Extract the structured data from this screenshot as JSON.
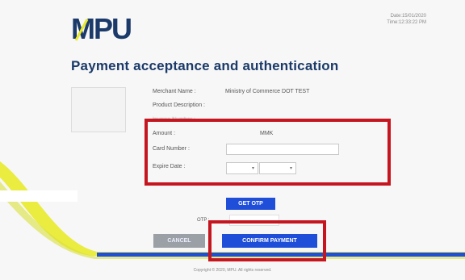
{
  "header": {
    "logo_text": "MPU",
    "date": "Date:15/01/2020",
    "time": "Time:12:33:22 PM"
  },
  "page": {
    "title": "Payment acceptance and authentication"
  },
  "details": {
    "merchant_label": "Merchant Name :",
    "merchant_value": "Ministry of Commerce DOT TEST",
    "product_label": "Product Description :",
    "invoice_label": "Invoice Number :",
    "amount_label": "Amount :",
    "amount_currency": "MMK",
    "card_label": "Card Number :",
    "expire_label": "Expire Date :"
  },
  "buttons": {
    "get_otp": "GET OTP",
    "cancel": "CANCEL",
    "confirm": "CONFIRM PAYMENT"
  },
  "otp": {
    "label": "OTP :"
  },
  "footer": {
    "copyright": "Copyright © 2020, MPU. All rights reserved."
  },
  "colors": {
    "brand_blue": "#1b3a69",
    "button_blue": "#1f4fd9",
    "highlight_red": "#c51620",
    "accent_yellow": "#e8ea2a"
  }
}
